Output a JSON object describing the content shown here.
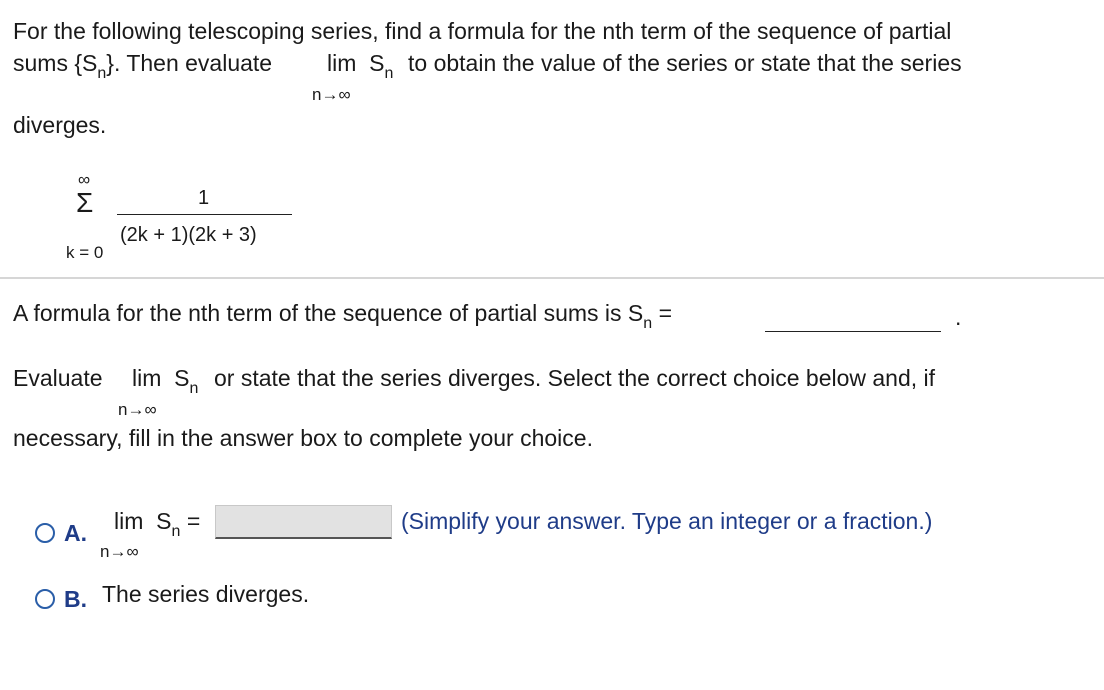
{
  "question": {
    "line1": "For the following telescoping series, find a formula for the nth term of the sequence of partial",
    "line2_a": "sums {S",
    "line2_sub": "n",
    "line2_b": "}. Then evaluate",
    "lim": "lim",
    "S": "S",
    "sub_n": "n",
    "line2_c": "to obtain the value of the series or state that the series",
    "lim_under": "n→∞",
    "line3": "diverges."
  },
  "series": {
    "upper": "∞",
    "sigma": "Σ",
    "lower": "k = 0",
    "numerator": "1",
    "denominator": "(2k + 1)(2k + 3)"
  },
  "part1": {
    "text": "A formula for the nth term of the sequence of partial sums is S",
    "sub": "n",
    "equals": "=",
    "period": "."
  },
  "part2": {
    "evaluate": "Evaluate",
    "lim": "lim",
    "S": "S",
    "sub": "n",
    "rest": "or state that the series diverges. Select the correct choice below and, if",
    "lim_under": "n→∞",
    "line2": "necessary, fill in the answer box to complete your choice."
  },
  "choices": {
    "a": {
      "letter": "A.",
      "lim": "lim",
      "S": "S",
      "sub": "n",
      "equals": "=",
      "lim_under": "n→∞",
      "hint": "(Simplify your answer. Type an integer or a fraction.)",
      "input_value": ""
    },
    "b": {
      "letter": "B.",
      "text": "The series diverges."
    }
  }
}
